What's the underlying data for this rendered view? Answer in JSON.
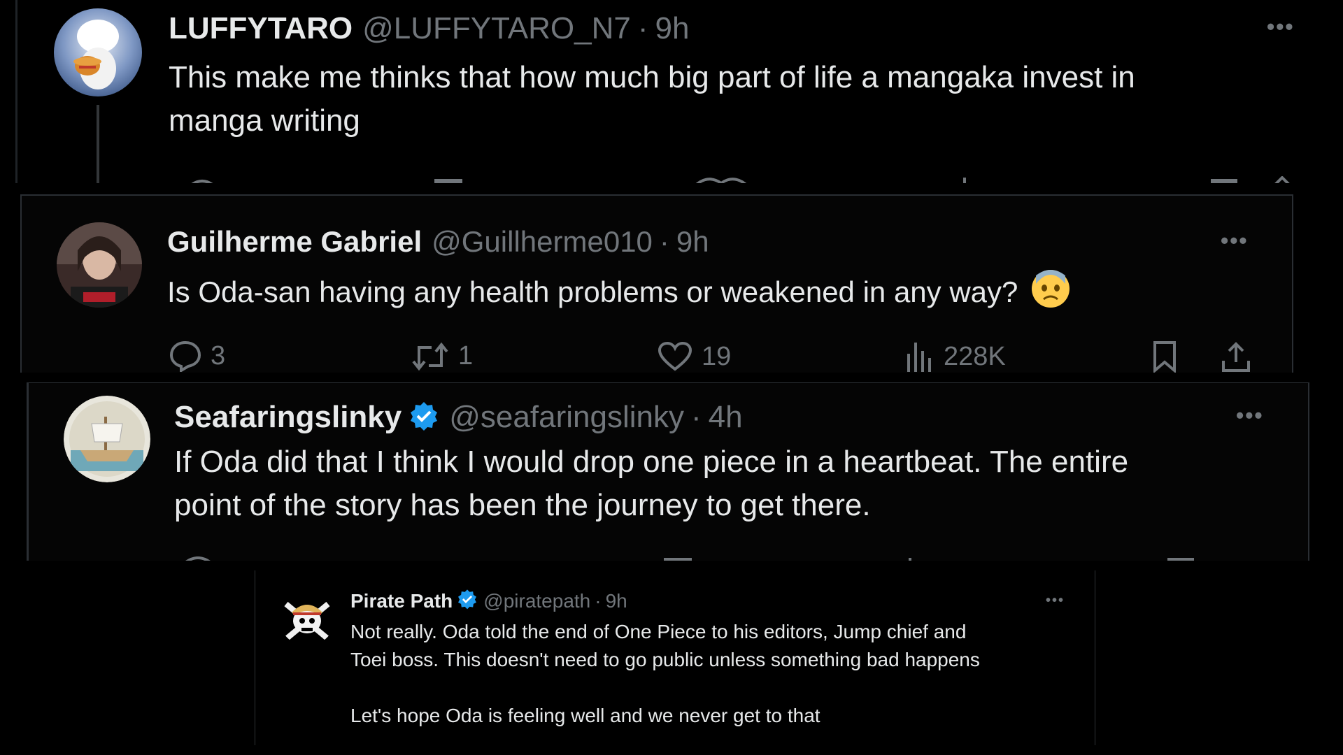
{
  "colors": {
    "background": "#000000",
    "text_primary": "#e7e9ea",
    "text_secondary": "#71767b",
    "verified_blue": "#1d9bf0",
    "border": "#2f3336"
  },
  "tweets": [
    {
      "display_name": "LUFFYTARO",
      "handle": "@LUFFYTARO_N7",
      "separator": "·",
      "time": "9h",
      "text": "This make me thinks that how much big part of life a mangaka invest in\nmanga writing",
      "more_icon": "more-icon",
      "avatar_icon": "luffy-gear5-avatar"
    },
    {
      "display_name": "Guilherme Gabriel",
      "handle": "@Guillherme010",
      "separator": "·",
      "time": "9h",
      "text": "Is Oda-san having any health problems or weakened in any way?",
      "emoji": "😨",
      "more_icon": "more-icon",
      "avatar_icon": "user-photo-avatar",
      "actions": {
        "replies": "3",
        "reposts": "1",
        "likes": "19",
        "views": "228K"
      }
    },
    {
      "display_name": "Seafaringslinky",
      "handle": "@seafaringslinky",
      "separator": "·",
      "time": "4h",
      "verified": true,
      "text": "If Oda did that I think I would drop one piece in a heartbeat. The entire\npoint of the story has been the journey to get there.",
      "more_icon": "more-icon",
      "avatar_icon": "ship-avatar"
    },
    {
      "display_name": "Pirate Path",
      "handle": "@piratepath",
      "separator": "·",
      "time": "9h",
      "verified": true,
      "text": "Not really. Oda told the end of One Piece to his editors, Jump chief and\nToei boss. This doesn't need to go public unless something bad happens\n\nLet's hope Oda is feeling well and we never get to that",
      "more_icon": "more-icon",
      "avatar_icon": "jolly-roger-avatar"
    }
  ],
  "more_label": "•••"
}
